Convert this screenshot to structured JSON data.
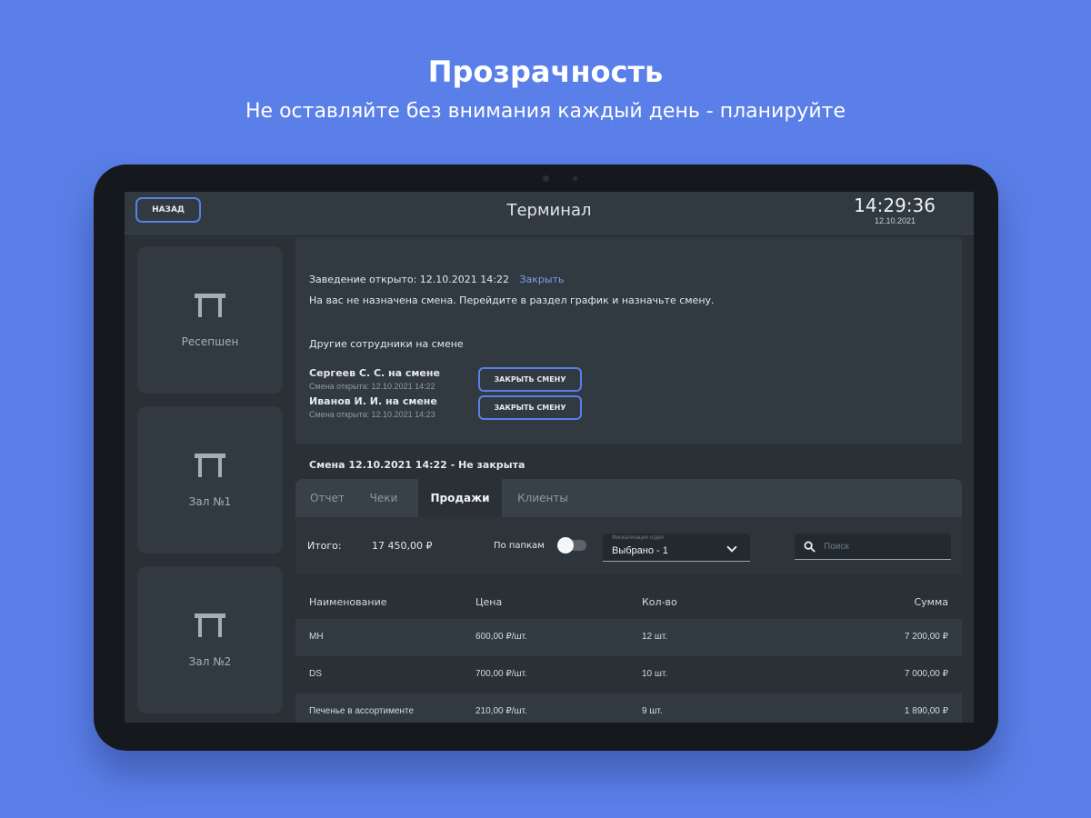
{
  "promo": {
    "title": "Прозрачность",
    "subtitle": "Не оставляйте без внимания каждый день - планируйте"
  },
  "header": {
    "back_label": "НАЗАД",
    "title": "Терминал",
    "time": "14:29:36",
    "date": "12.10.2021"
  },
  "sidebar": {
    "items": [
      {
        "label": "Ресепшен",
        "icon": "table-icon"
      },
      {
        "label": "Зал №1",
        "icon": "table-icon"
      },
      {
        "label": "Зал №2",
        "icon": "table-icon"
      }
    ]
  },
  "info": {
    "opened_text": "Заведение открыто: 12.10.2021 14:22",
    "close_link": "Закрыть",
    "no_shift_text": "На вас не назначена смена. Перейдите в раздел график и назначьте смену.",
    "others_heading": "Другие сотрудники на смене",
    "staff": [
      {
        "name": "Сергеев С. С. на смене",
        "opened": "Смена открыта: 12.10.2021 14:22",
        "button": "ЗАКРЫТЬ СМЕНУ"
      },
      {
        "name": "Иванов И. И. на смене",
        "opened": "Смена открыта: 12.10.2021 14:23",
        "button": "ЗАКРЫТЬ СМЕНУ"
      }
    ]
  },
  "shift": {
    "title": "Смена 12.10.2021 14:22 - Не закрыта",
    "tabs": [
      "Отчет",
      "Чеки",
      "Продажи",
      "Клиенты"
    ],
    "active_tab": "Продажи"
  },
  "sales": {
    "total_label": "Итого:",
    "total_value": "17 450,00 ₽",
    "folders_label": "По папкам",
    "folders_enabled": false,
    "select_caption": "Фискализация отдел",
    "select_value": "Выбрано - 1",
    "search_placeholder": "Поиск",
    "search_value": "",
    "columns": [
      "Наименование",
      "Цена",
      "Кол-во",
      "Сумма"
    ],
    "rows": [
      {
        "name": "МН",
        "price": "600,00 ₽/шт.",
        "qty": "12 шт.",
        "sum": "7 200,00 ₽"
      },
      {
        "name": "DS",
        "price": "700,00 ₽/шт.",
        "qty": "10 шт.",
        "sum": "7 000,00 ₽"
      },
      {
        "name": "Печенье в ассортименте",
        "price": "210,00 ₽/шт.",
        "qty": "9 шт.",
        "sum": "1 890,00 ₽"
      }
    ]
  },
  "colors": {
    "background": "#5a7fe8",
    "accent": "#5a7fe8",
    "panel": "#323a41",
    "screen": "#2a3036"
  }
}
